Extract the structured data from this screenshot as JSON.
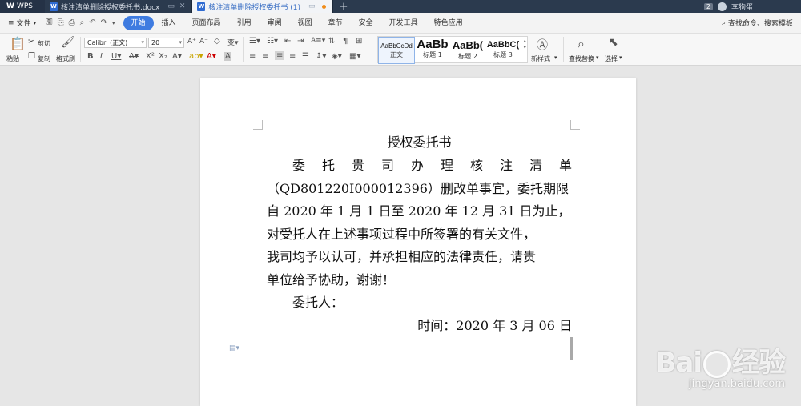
{
  "titlebar": {
    "app_name": "WPS",
    "tabs": [
      {
        "label": "核注清单删除授权委托书.docx",
        "active": false
      },
      {
        "label": "核注清单删除授权委托书 (1)",
        "active": true
      }
    ],
    "window_badge": "2",
    "user_name": "李狗蛋"
  },
  "menubar": {
    "file_label": "文件",
    "tabs": [
      "开始",
      "插入",
      "页面布局",
      "引用",
      "审阅",
      "视图",
      "章节",
      "安全",
      "开发工具",
      "特色应用"
    ],
    "active_tab": "开始",
    "search_label": "查找命令、搜索模板"
  },
  "ribbon": {
    "paste_label": "粘贴",
    "cut_label": "剪切",
    "copy_label": "复制",
    "format_painter_label": "格式刷",
    "font_name": "Calibri (正文)",
    "font_size": "20",
    "styles": [
      {
        "sample": "AaBbCcDd",
        "label": "正文"
      },
      {
        "sample": "AaBb",
        "label": "标题 1"
      },
      {
        "sample": "AaBb(",
        "label": "标题 2"
      },
      {
        "sample": "AaBbC(",
        "label": "标题 3"
      }
    ],
    "new_style_label": "新样式",
    "find_replace_label": "查找替换",
    "select_label": "选择"
  },
  "document": {
    "title": "授权委托书",
    "lines": [
      "委托贵司办理核注清单",
      "（QD801220I000012396）删改单事宜，委托期限",
      "自 2020 年 1 月 1 日至 2020 年 12 月 31 日为止，",
      "对受托人在上述事项过程中所签署的有关文件，",
      "我司均予以认可，并承担相应的法律责任，请贵",
      "单位给予协助，谢谢！"
    ],
    "client_label": "委托人：",
    "date_line": "时间：2020 年 3 月 06 日"
  },
  "watermark": {
    "logo": "Bai",
    "logo_suffix": "经验",
    "url": "jingyan.baidu.com"
  }
}
